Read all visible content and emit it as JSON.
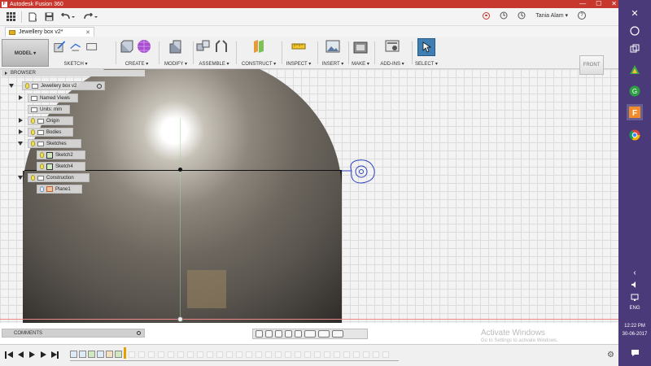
{
  "window": {
    "title": "Autodesk Fusion 360",
    "logo_letter": "F",
    "minimize": "—",
    "maximize": "☐",
    "close": "✕"
  },
  "qab": {
    "grid_icon": "grid-icon",
    "file_icon": "file-icon",
    "save_icon": "save-icon",
    "undo_icon": "undo-icon",
    "redo_icon": "redo-icon",
    "user": "Tania Alam ▾",
    "help": "?"
  },
  "tab": {
    "name": "Jewellery box v2*",
    "close": "✕"
  },
  "toolbar": {
    "model": "MODEL ▾",
    "sketch": "SKETCH ▾",
    "create": "CREATE ▾",
    "modify": "MODIFY ▾",
    "assemble": "ASSEMBLE ▾",
    "construct": "CONSTRUCT ▾",
    "inspect": "INSPECT ▾",
    "insert": "INSERT ▾",
    "make": "MAKE ▾",
    "addins": "ADD-INS ▾",
    "select": "SELECT ▾"
  },
  "browser": {
    "header": "BROWSER",
    "root": "Jewellery box v2",
    "items": [
      {
        "label": "Named Views"
      },
      {
        "label": "Units: mm"
      },
      {
        "label": "Origin"
      },
      {
        "label": "Bodies"
      },
      {
        "label": "Sketches"
      },
      {
        "label": "Sketch2"
      },
      {
        "label": "Sketch4"
      },
      {
        "label": "Construction"
      },
      {
        "label": "Plane1"
      }
    ]
  },
  "viewcube": {
    "face": "FRONT"
  },
  "comments": {
    "label": "COMMENTS"
  },
  "watermark": {
    "title": "Activate Windows",
    "subtitle": "Go to Settings to activate Windows."
  },
  "taskbar": {
    "lang": "ENG",
    "time": "12:22 PM",
    "date": "30-06-2017"
  },
  "colors": {
    "titlebar": "#c8372d",
    "taskbar": "#4a3a7a",
    "sketch_blue": "#2b3fbf"
  }
}
